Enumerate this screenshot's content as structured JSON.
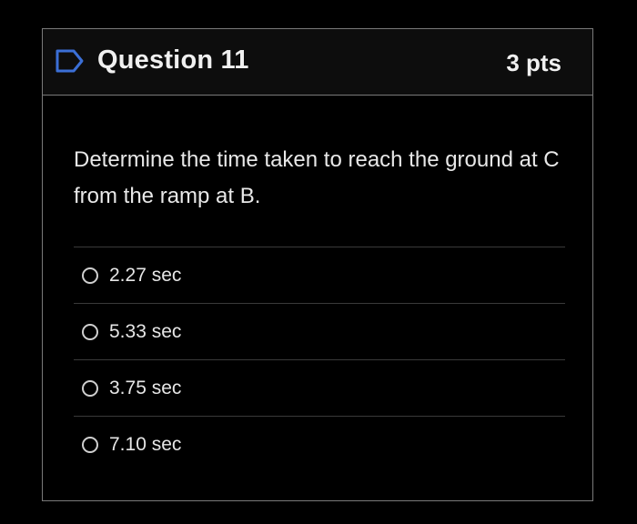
{
  "question": {
    "title": "Question 11",
    "points": "3 pts",
    "flag_icon": "flag-icon",
    "text": "Determine the time taken to reach the ground at C from the ramp at B."
  },
  "answers": [
    {
      "label": "2.27 sec"
    },
    {
      "label": "5.33 sec"
    },
    {
      "label": "3.75 sec"
    },
    {
      "label": "7.10 sec"
    }
  ],
  "colors": {
    "background": "#000000",
    "border": "#7a7a7a",
    "flag_outline": "#3b6fd6",
    "text": "#e6e6e6"
  }
}
